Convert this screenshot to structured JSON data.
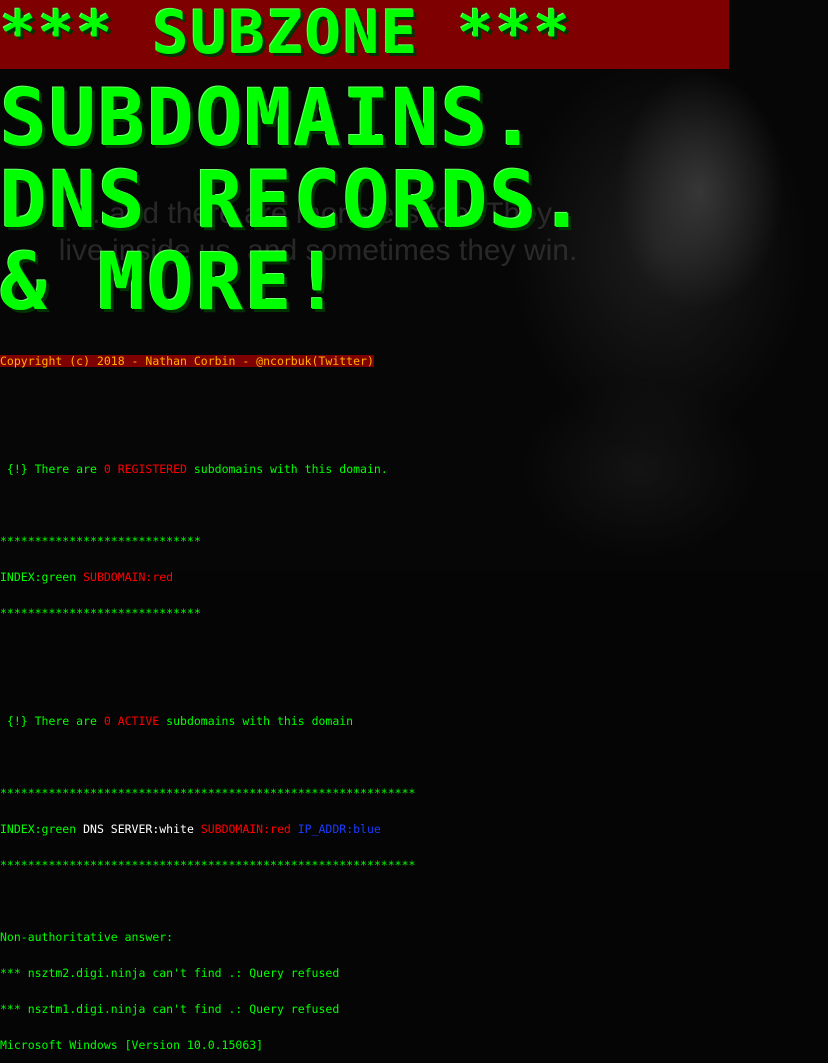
{
  "banner": {
    "title": "*** SUBZONE ***",
    "line1": "SUBDOMAINS.",
    "line2": "DNS RECORDS.",
    "line3": "& MORE!"
  },
  "background_text": "...and there are monsters too. They live inside us, and sometimes they win.",
  "terminal": {
    "copyright": "Copyright (c) 2018 - Nathan Corbin - @ncorbuk(Twitter)",
    "registered": {
      "prefix": " {!} There are ",
      "count": "0 REGISTERED",
      "suffix": " subdomains with this domain."
    },
    "sep_short": "*****************************",
    "index1": {
      "index": "INDEX:green ",
      "sub": "SUBDOMAIN:red"
    },
    "active": {
      "prefix": " {!} There are ",
      "count": "0 ACTIVE",
      "suffix": " subdomains with this domain"
    },
    "sep_long": "************************************************************",
    "index2": {
      "index": "INDEX:green ",
      "dns": "DNS SERVER:white ",
      "sub": "SUBDOMAIN:red ",
      "ip": "IP_ADDR:blue"
    },
    "nonauth": "Non-authoritative answer:",
    "ns2": "*** nsztm2.digi.ninja can't find .: Query refused",
    "ns1": "*** nsztm1.digi.ninja can't find .: Query refused",
    "winver": "Microsoft Windows [Version 10.0.15063]"
  },
  "colors": {
    "accent": "#00ff00",
    "banner_bg": "#7f0000",
    "red": "#ff0000",
    "blue": "#1a3cff",
    "white": "#ffffff"
  }
}
